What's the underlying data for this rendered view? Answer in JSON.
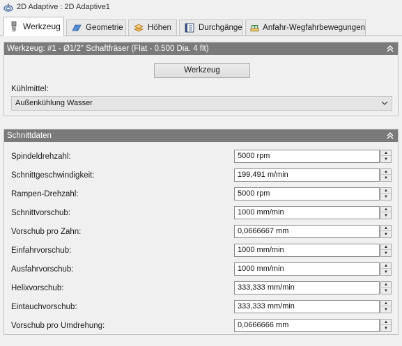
{
  "window": {
    "title": "2D Adaptive : 2D Adaptive1"
  },
  "tabs": [
    {
      "label": "Werkzeug",
      "icon": "tool-icon",
      "active": true
    },
    {
      "label": "Geometrie",
      "icon": "geometry-icon",
      "active": false
    },
    {
      "label": "Höhen",
      "icon": "heights-icon",
      "active": false
    },
    {
      "label": "Durchgänge",
      "icon": "passes-icon",
      "active": false
    },
    {
      "label": "Anfahr-Wegfahrbewegungen",
      "icon": "linking-icon",
      "active": false
    }
  ],
  "tool_panel": {
    "header": "Werkzeug: #1 - Ø1/2\" Schaftfräser (Flat - 0.500 Dia. 4 flt)",
    "tool_button": "Werkzeug",
    "coolant_label": "Kühlmittel:",
    "coolant_value": "Außenkühlung Wasser"
  },
  "cutting_panel": {
    "header": "Schnittdaten",
    "rows": [
      {
        "label": "Spindeldrehzahl:",
        "value": "5000 rpm"
      },
      {
        "label": "Schnittgeschwindigkeit:",
        "value": "199,491 m/min"
      },
      {
        "label": "Rampen-Drehzahl:",
        "value": "5000 rpm"
      },
      {
        "label": "Schnittvorschub:",
        "value": "1000 mm/min"
      },
      {
        "label": "Vorschub pro Zahn:",
        "value": "0,0666667 mm"
      },
      {
        "label": "Einfahrvorschub:",
        "value": "1000 mm/min"
      },
      {
        "label": "Ausfahrvorschub:",
        "value": "1000 mm/min"
      },
      {
        "label": "Helixvorschub:",
        "value": "333,333 mm/min"
      },
      {
        "label": "Eintauchvorschub:",
        "value": "333,333 mm/min"
      },
      {
        "label": "Vorschub pro Umdrehung:",
        "value": "0,0666666 mm"
      }
    ]
  },
  "colors": {
    "panel_header": "#7a7a7a",
    "background": "#f0f0f0"
  }
}
